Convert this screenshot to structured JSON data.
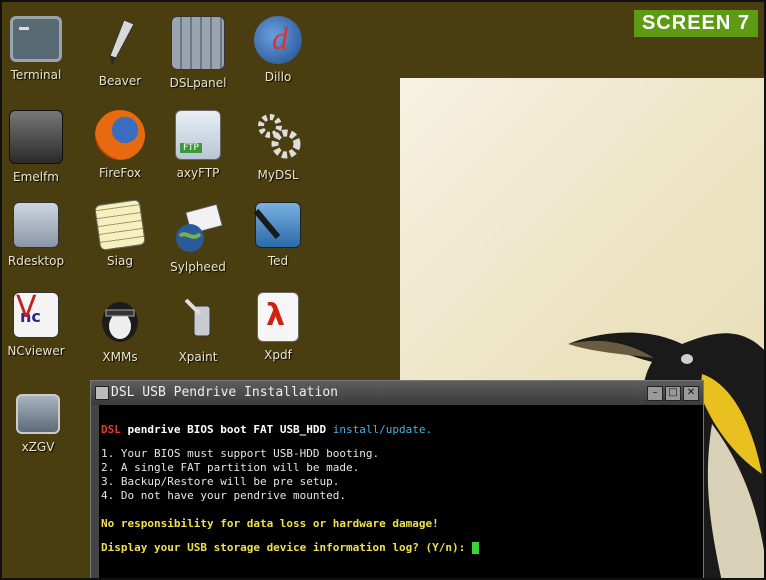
{
  "badge": "SCREEN 7",
  "desktop_icons": [
    {
      "label": "Terminal",
      "icon": "terminal-icon"
    },
    {
      "label": "Beaver",
      "icon": "pen-icon"
    },
    {
      "label": "DSLpanel",
      "icon": "panel-icon"
    },
    {
      "label": "Dillo",
      "icon": "dillo-globe-icon"
    },
    {
      "label": "Emelfm",
      "icon": "file-manager-icon"
    },
    {
      "label": "FireFox",
      "icon": "firefox-icon"
    },
    {
      "label": "axyFTP",
      "icon": "ftp-icon"
    },
    {
      "label": "MyDSL",
      "icon": "gears-icon"
    },
    {
      "label": "Rdesktop",
      "icon": "rdesktop-icon"
    },
    {
      "label": "Siag",
      "icon": "spreadsheet-icon"
    },
    {
      "label": "Sylpheed",
      "icon": "mail-globe-icon"
    },
    {
      "label": "Ted",
      "icon": "ted-pen-icon"
    },
    {
      "label": "NCviewer",
      "icon": "vnc-icon"
    },
    {
      "label": "XMMs",
      "icon": "xmms-penguin-icon"
    },
    {
      "label": "Xpaint",
      "icon": "paint-icon"
    },
    {
      "label": "Xpdf",
      "icon": "pdf-icon"
    },
    {
      "label": "xZGV",
      "icon": "image-viewer-icon"
    }
  ],
  "terminal": {
    "title": "DSL USB Pendrive Installation",
    "header_prefix": "DSL",
    "header_main": " pendrive BIOS boot FAT USB_HDD ",
    "header_suffix": "install/update.",
    "lines": [
      "1. Your BIOS must support USB-HDD booting.",
      "2. A single FAT partition will be made.",
      "3. Backup/Restore will be pre setup.",
      "4. Do not have your pendrive mounted."
    ],
    "warning": "No responsibility for data loss or hardware damage!",
    "prompt": "Display your USB storage device information log? (Y/n): "
  },
  "colors": {
    "badge": "#5f9a14",
    "desktop": "#4a3e10",
    "cursor": "#3bd33b"
  }
}
